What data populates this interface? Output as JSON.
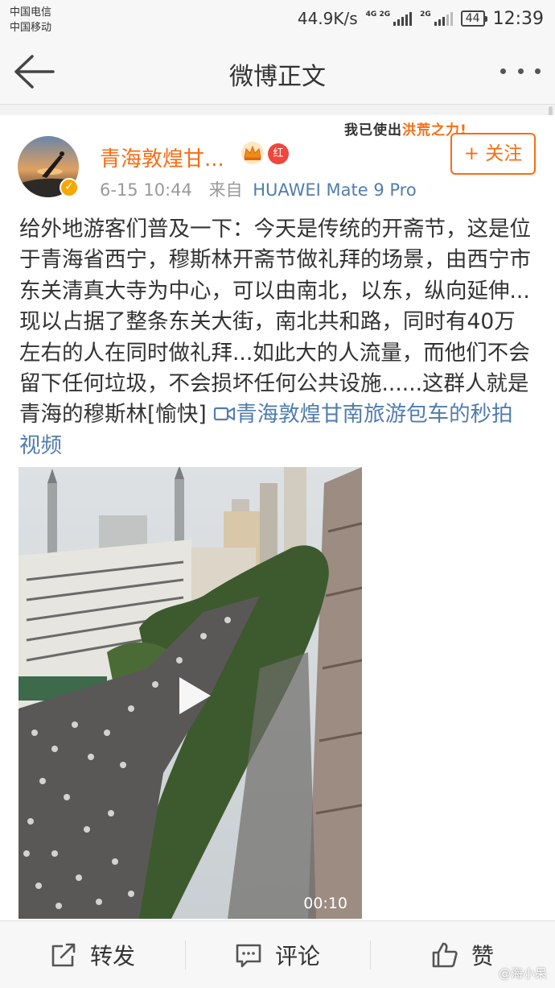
{
  "status_bar": {
    "carrier_1": "中国电信",
    "carrier_2": "中国移动",
    "net_speed": "44.9K/s",
    "sim1_net": "4G 2G",
    "sim2_net": "2G",
    "battery": "44",
    "time": "12:39"
  },
  "nav": {
    "title": "微博正文"
  },
  "post": {
    "username": "青海敦煌甘...",
    "badge_label": "红",
    "timestamp": "6-15 10:44",
    "source_prefix": "来自",
    "device": "HUAWEI Mate 9 Pro",
    "decoration_text_a": "我已使出",
    "decoration_text_b": "洪荒之力",
    "decoration_text_c": "!",
    "follow_label": "+ 关注",
    "text": "给外地游客们普及一下：今天是传统的开斋节，这是位于青海省西宁，穆斯林开斋节做礼拜的场景，由西宁市东关清真大寺为中心，可以由南北，以东，纵向延伸...现以占据了整条东关大街，南北共和路，同时有40万左右的人在同时做礼拜...如此大的人流量，而他们不会留下任何垃圾，不会损坏任何公共设施......这群人就是青海的穆斯林[愉快] ",
    "video_link_text": "青海敦煌甘南旅游包车的秒拍视频",
    "video_duration": "00:10"
  },
  "actions": {
    "repost": "转发",
    "comment": "评论",
    "like": "赞"
  },
  "watermark": "@海小呆",
  "colors": {
    "accent": "#f86c14",
    "link": "#507daf",
    "verified": "#f6a800"
  }
}
